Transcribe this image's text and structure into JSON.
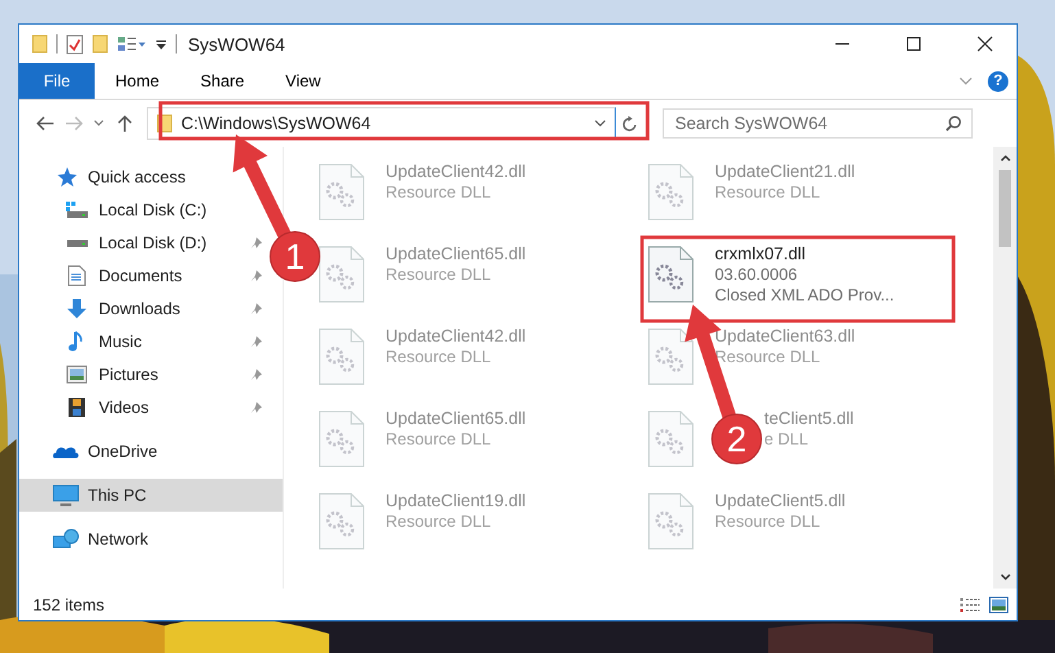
{
  "window": {
    "title": "SysWOW64"
  },
  "ribbon": {
    "file_tab": "File",
    "tabs": [
      "Home",
      "Share",
      "View"
    ],
    "help": "?"
  },
  "address": {
    "path": "C:\\Windows\\SysWOW64"
  },
  "search": {
    "placeholder": "Search SysWOW64"
  },
  "navigation": [
    {
      "label": "Quick access",
      "kind": "star",
      "selected": false,
      "children": [
        {
          "label": "Local Disk (C:)",
          "kind": "drive-system",
          "pinned": false,
          "selected": false
        },
        {
          "label": "Local Disk (D:)",
          "kind": "drive",
          "pinned": true,
          "selected": false
        },
        {
          "label": "Documents",
          "kind": "document",
          "pinned": true,
          "selected": false
        },
        {
          "label": "Downloads",
          "kind": "download",
          "pinned": true,
          "selected": false
        },
        {
          "label": "Music",
          "kind": "music",
          "pinned": true,
          "selected": false
        },
        {
          "label": "Pictures",
          "kind": "pictures",
          "pinned": true,
          "selected": false
        },
        {
          "label": "Videos",
          "kind": "videos",
          "pinned": true,
          "selected": false
        }
      ]
    },
    {
      "label": "OneDrive",
      "kind": "cloud",
      "selected": false
    },
    {
      "label": "This PC",
      "kind": "pc",
      "selected": true
    },
    {
      "label": "Network",
      "kind": "network",
      "selected": false
    }
  ],
  "files": [
    {
      "name": "UpdateClient42.dll",
      "details": [
        "Resource DLL"
      ],
      "highlighted": false
    },
    {
      "name": "UpdateClient21.dll",
      "details": [
        "Resource DLL"
      ],
      "highlighted": false
    },
    {
      "name": "UpdateClient65.dll",
      "details": [
        "Resource DLL"
      ],
      "highlighted": false
    },
    {
      "name": "crxmlx07.dll",
      "details": [
        "03.60.0006",
        "Closed XML ADO Prov..."
      ],
      "highlighted": true
    },
    {
      "name": "UpdateClient42.dll",
      "details": [
        "Resource DLL"
      ],
      "highlighted": false
    },
    {
      "name": "UpdateClient63.dll",
      "details": [
        "Resource DLL"
      ],
      "highlighted": false
    },
    {
      "name": "UpdateClient65.dll",
      "details": [
        "Resource DLL"
      ],
      "highlighted": false
    },
    {
      "name": "teClient5.dll",
      "details": [
        "e DLL"
      ],
      "highlighted": false,
      "covered": true
    },
    {
      "name": "UpdateClient19.dll",
      "details": [
        "Resource DLL"
      ],
      "highlighted": false
    },
    {
      "name": "UpdateClient5.dll",
      "details": [
        "Resource DLL"
      ],
      "highlighted": false
    }
  ],
  "status_bar": {
    "item_count": "152 items"
  },
  "annotations": [
    {
      "number": "1"
    },
    {
      "number": "2"
    }
  ]
}
